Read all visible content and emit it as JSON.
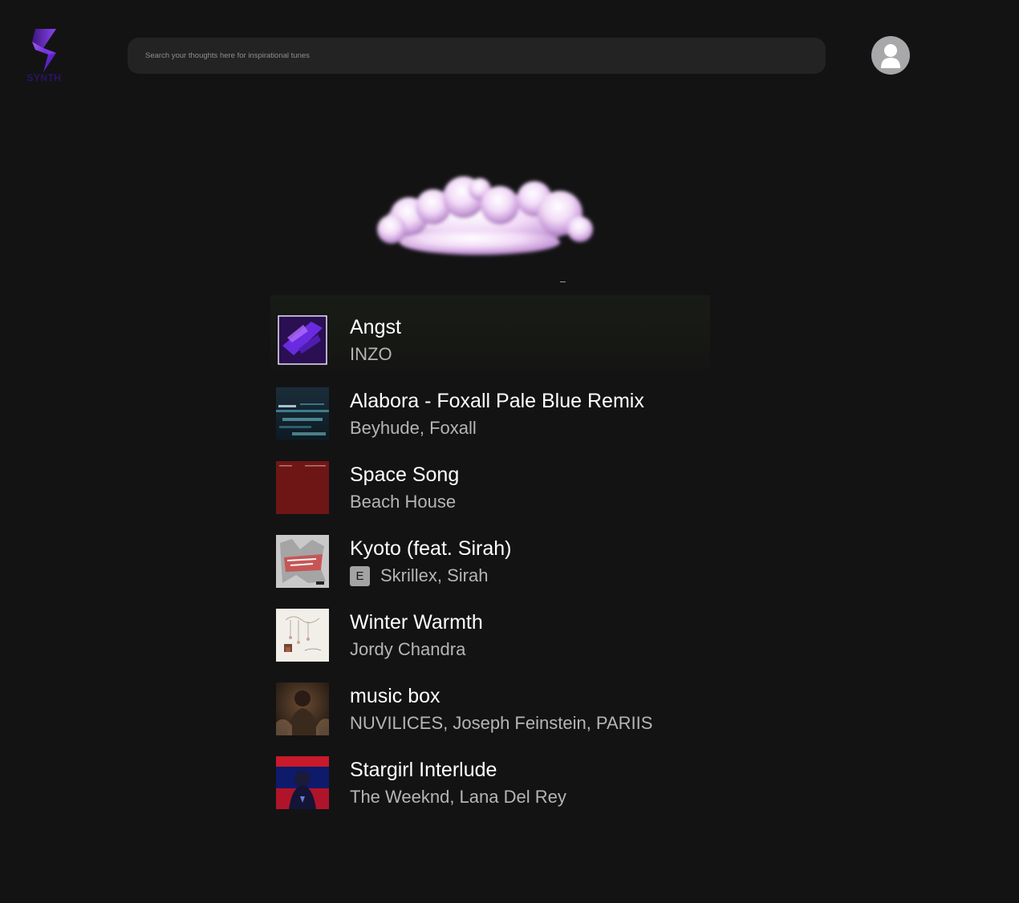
{
  "logo": {
    "text": "SYNTH",
    "icon": "lightning-s-icon",
    "color": "#6b2bd9"
  },
  "search": {
    "placeholder": "Search your thoughts here for inspirational tunes",
    "value": ""
  },
  "profile": {
    "icon": "user-icon"
  },
  "tracks": [
    {
      "title": "Angst",
      "artist": "INZO",
      "explicit": false,
      "active": true
    },
    {
      "title": "Alabora - Foxall Pale Blue Remix",
      "artist": "Beyhude, Foxall",
      "explicit": false
    },
    {
      "title": "Space Song",
      "artist": "Beach House",
      "explicit": false
    },
    {
      "title": "Kyoto (feat. Sirah)",
      "artist": "Skrillex, Sirah",
      "explicit": true,
      "explicit_label": "E"
    },
    {
      "title": "Winter Warmth",
      "artist": "Jordy Chandra",
      "explicit": false
    },
    {
      "title": "music box",
      "artist": "NUVILICES, Joseph Feinstein, PARIIS",
      "explicit": false
    },
    {
      "title": "Stargirl Interlude",
      "artist": "The Weeknd, Lana Del Rey",
      "explicit": false
    }
  ],
  "colors": {
    "background": "#131314",
    "search_bg": "#232324",
    "accent": "#6b2bd9"
  }
}
